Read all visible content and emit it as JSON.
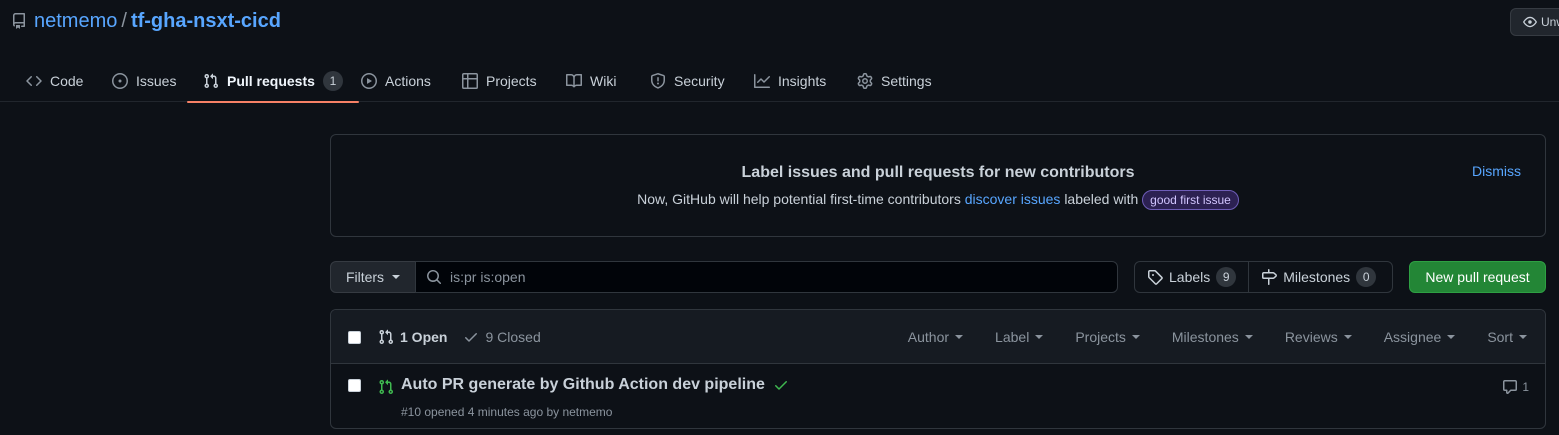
{
  "repo": {
    "owner": "netmemo",
    "separator": "/",
    "name": "tf-gha-nsxt-cicd",
    "watch_label": "Unwatch"
  },
  "tabs": [
    {
      "label": "Code",
      "icon": "code-icon"
    },
    {
      "label": "Issues",
      "icon": "issue-opened-icon"
    },
    {
      "label": "Pull requests",
      "icon": "git-pull-request-icon",
      "count": "1",
      "active": true
    },
    {
      "label": "Actions",
      "icon": "play-icon"
    },
    {
      "label": "Projects",
      "icon": "table-icon"
    },
    {
      "label": "Wiki",
      "icon": "book-icon"
    },
    {
      "label": "Security",
      "icon": "shield-icon"
    },
    {
      "label": "Insights",
      "icon": "graph-icon"
    },
    {
      "label": "Settings",
      "icon": "gear-icon"
    }
  ],
  "banner": {
    "title": "Label issues and pull requests for new contributors",
    "text_before": "Now, GitHub will help potential first-time contributors",
    "link_text": "discover issues",
    "text_after": "labeled with",
    "label": "good first issue",
    "dismiss": "Dismiss"
  },
  "filterbar": {
    "filters_label": "Filters",
    "search_value": "is:pr is:open",
    "labels_label": "Labels",
    "labels_count": "9",
    "milestones_label": "Milestones",
    "milestones_count": "0",
    "new_pr_label": "New pull request"
  },
  "list": {
    "open_label": "1 Open",
    "closed_label": "9 Closed",
    "header_filters": [
      "Author",
      "Label",
      "Projects",
      "Milestones",
      "Reviews",
      "Assignee",
      "Sort"
    ],
    "items": [
      {
        "title": "Auto PR generate by Github Action dev pipeline",
        "meta": "#10 opened 4 minutes ago by netmemo",
        "comments": "1",
        "status": "success"
      }
    ]
  },
  "colors": {
    "accent": "#58a6ff",
    "tab_underline": "#f78166",
    "primary_button": "#238636",
    "open_green": "#3fb950"
  }
}
